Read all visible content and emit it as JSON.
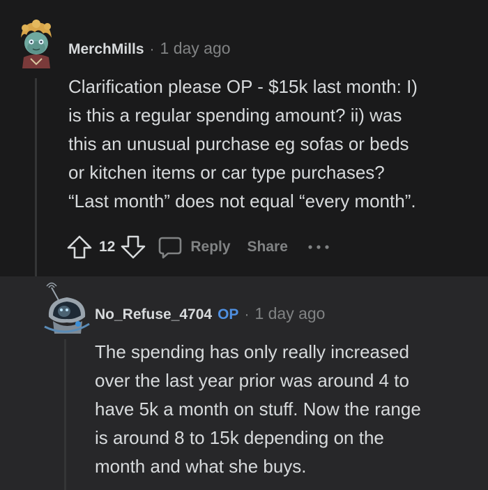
{
  "comments": [
    {
      "username": "MerchMills",
      "separator": "·",
      "time": "1 day ago",
      "body_lines": [
        "Clarification please OP - $15k last month: I)",
        "is this a regular spending amount? ii) was",
        "this an unusual purchase eg sofas or beds",
        "or kitchen items or car type purchases?",
        "“Last month” does not equal “every month”."
      ],
      "votes": "12",
      "actions": {
        "reply": "Reply",
        "share": "Share"
      }
    },
    {
      "username": "No_Refuse_4704",
      "op_badge": "OP",
      "separator": "·",
      "time": "1 day ago",
      "body_lines": [
        "The spending has only really increased",
        "over the last year prior was around 4 to",
        "have 5k a month on stuff. Now the range",
        "is around 8 to 15k depending on the",
        "month and what she buys."
      ]
    }
  ],
  "colors": {
    "background": "#1a1a1b",
    "reply_background": "#272729",
    "text": "#d7dadc",
    "muted": "#818384",
    "op_blue": "#4f8fe0"
  },
  "icons": {
    "upvote": "arrow-up-icon",
    "downvote": "arrow-down-icon",
    "reply": "speech-bubble-icon",
    "more": "ellipsis-icon"
  }
}
